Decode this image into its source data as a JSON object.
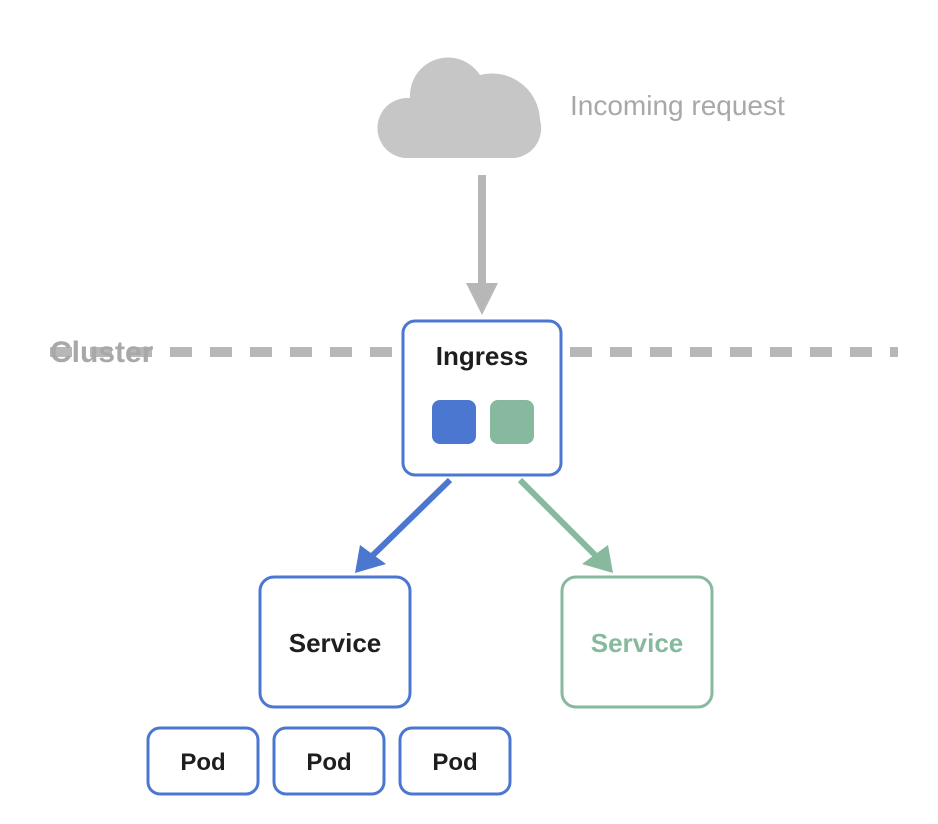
{
  "labels": {
    "incoming_request": "Incoming request",
    "cluster": "Cluster",
    "ingress": "Ingress",
    "service_blue": "Service",
    "service_green": "Service",
    "pod1": "Pod",
    "pod2": "Pod",
    "pod3": "Pod"
  },
  "colors": {
    "grey": "#b7b7b7",
    "grey_text": "#a8a8a8",
    "blue": "#4b77d1",
    "blue_fill": "#4b77d1",
    "green": "#87b99f",
    "green_fill": "#87b99f",
    "dark_text": "#1e1e1e"
  }
}
